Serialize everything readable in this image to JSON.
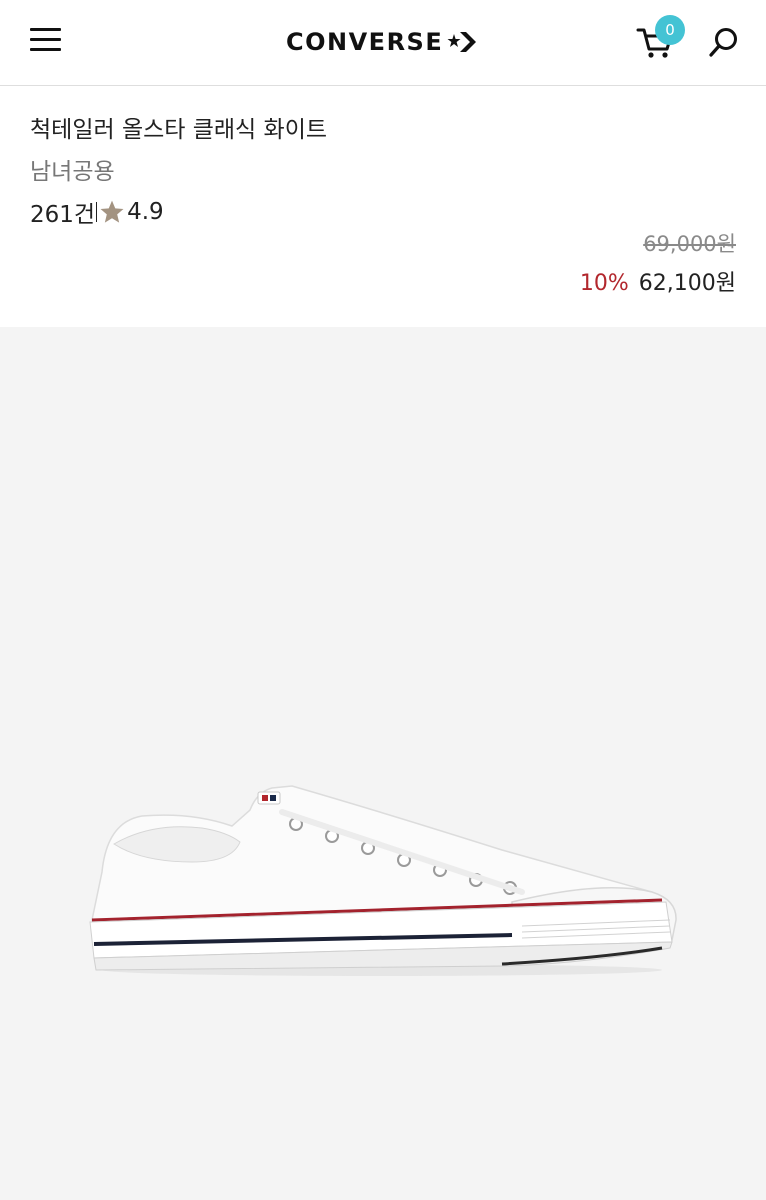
{
  "header": {
    "brand": "CONVERSE",
    "cart_count": "0"
  },
  "product": {
    "title": "척테일러 올스타 클래식 화이트",
    "gender": "남녀공용",
    "review_count": "261건",
    "rating": "4.9",
    "original_price": "69,000원",
    "discount": "10%",
    "sale_price": "62,100원"
  },
  "colors": {
    "accent_badge": "#44c3d4",
    "discount": "#b2272d",
    "star": "#a39381",
    "image_bg": "#f4f4f4"
  },
  "icons": {
    "menu": "hamburger-menu-icon",
    "cart": "shopping-cart-icon",
    "search": "search-icon",
    "rating": "star-icon"
  }
}
